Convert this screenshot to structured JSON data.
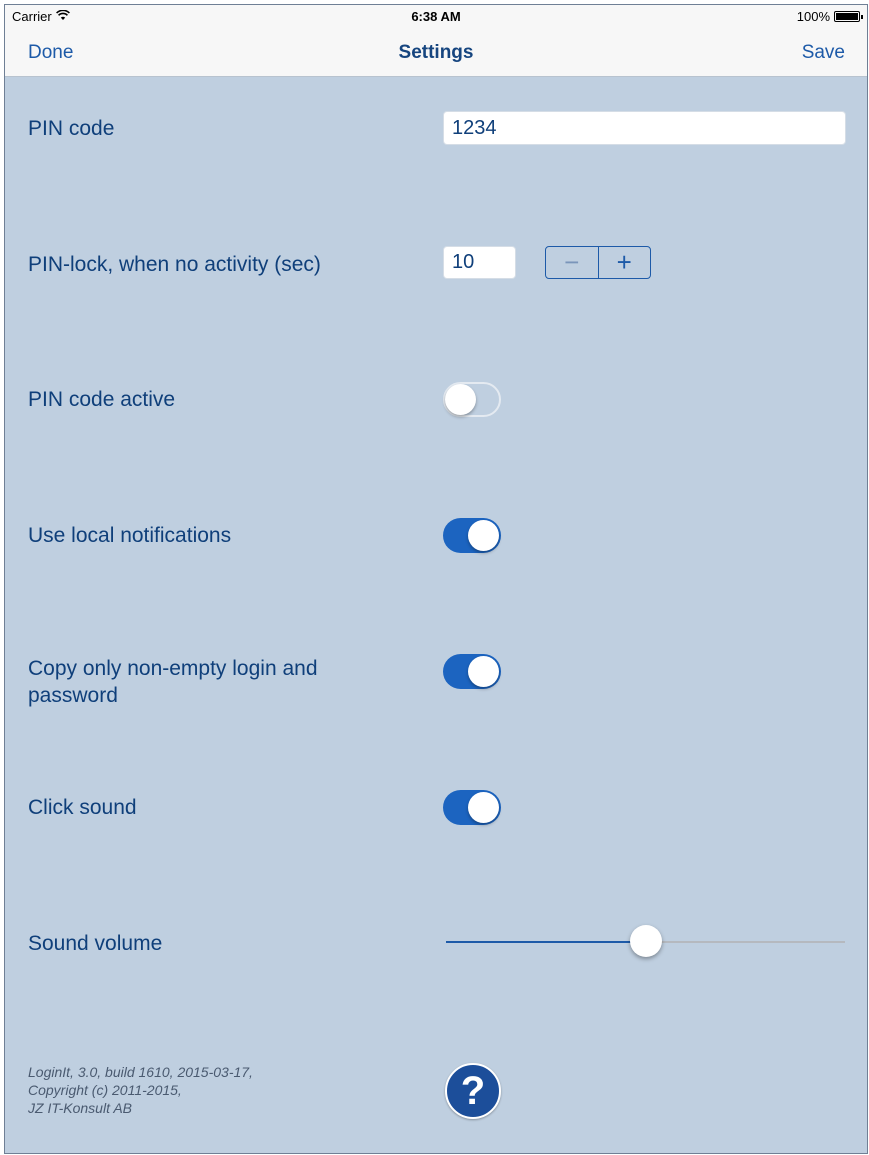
{
  "status_bar": {
    "carrier": "Carrier",
    "time": "6:38 AM",
    "battery": "100%"
  },
  "nav": {
    "left_button": "Done",
    "title": "Settings",
    "right_button": "Save"
  },
  "settings": {
    "pin_code": {
      "label": "PIN code",
      "value": "1234"
    },
    "pin_lock": {
      "label": "PIN-lock, when no activity (sec)",
      "value": "10",
      "minus": "−",
      "plus": "+"
    },
    "pin_active": {
      "label": "PIN code active",
      "on": false
    },
    "local_notifications": {
      "label": "Use local notifications",
      "on": true
    },
    "copy_nonempty": {
      "label_line1": "Copy only non-empty login and",
      "label_line2": "password",
      "on": true
    },
    "click_sound": {
      "label": "Click sound",
      "on": true
    },
    "sound_volume": {
      "label": "Sound volume",
      "level": 0.5
    }
  },
  "footer": {
    "line1": "LoginIt, 3.0, build 1610, 2015-03-17,",
    "line2": "Copyright (c) 2011-2015,",
    "line3": "JZ IT-Konsult AB",
    "help_glyph": "?"
  },
  "colors": {
    "background": "#bfcfe0",
    "accent": "#1d5aa8",
    "toggle_on": "#1c64c0"
  }
}
